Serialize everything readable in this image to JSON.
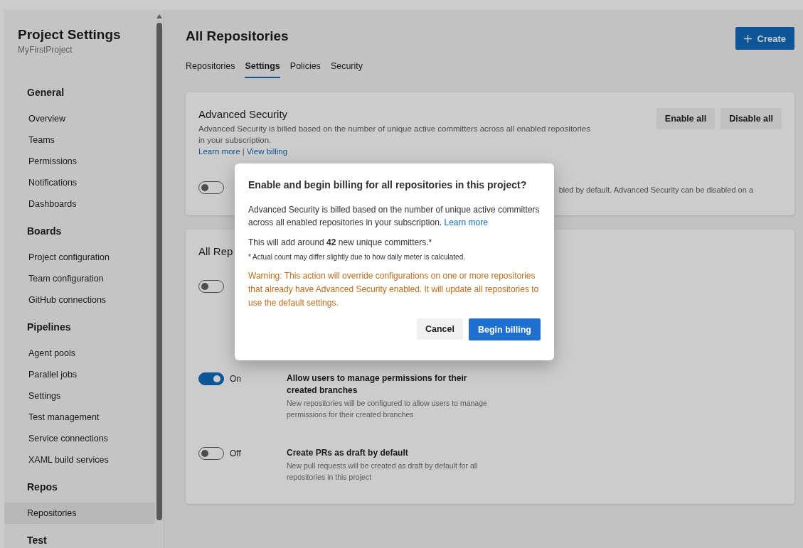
{
  "sidebar": {
    "title": "Project Settings",
    "subtitle": "MyFirstProject",
    "sections": [
      {
        "heading": "General",
        "items": [
          {
            "label": "Overview",
            "selected": false
          },
          {
            "label": "Teams",
            "selected": false
          },
          {
            "label": "Permissions",
            "selected": false
          },
          {
            "label": "Notifications",
            "selected": false
          },
          {
            "label": "Dashboards",
            "selected": false
          }
        ]
      },
      {
        "heading": "Boards",
        "items": [
          {
            "label": "Project configuration",
            "selected": false
          },
          {
            "label": "Team configuration",
            "selected": false
          },
          {
            "label": "GitHub connections",
            "selected": false
          }
        ]
      },
      {
        "heading": "Pipelines",
        "items": [
          {
            "label": "Agent pools",
            "selected": false
          },
          {
            "label": "Parallel jobs",
            "selected": false
          },
          {
            "label": "Settings",
            "selected": false
          },
          {
            "label": "Test management",
            "selected": false
          },
          {
            "label": "Service connections",
            "selected": false
          },
          {
            "label": "XAML build services",
            "selected": false
          }
        ]
      },
      {
        "heading": "Repos",
        "items": [
          {
            "label": "Repositories",
            "selected": true
          }
        ]
      },
      {
        "heading": "Test"
      }
    ]
  },
  "page": {
    "title": "All Repositories",
    "create_button": "Create",
    "tabs": [
      {
        "label": "Repositories",
        "selected": false
      },
      {
        "label": "Settings",
        "selected": true
      },
      {
        "label": "Policies",
        "selected": false
      },
      {
        "label": "Security",
        "selected": false
      }
    ]
  },
  "advanced_security": {
    "title": "Advanced Security",
    "description": "Advanced Security is billed based on the number of unique active committers across all enabled repositories in your subscription.",
    "links": [
      "Learn more",
      "View billing"
    ],
    "link_separator": "|",
    "buttons": [
      "Enable all",
      "Disable all"
    ],
    "toggle_on": false,
    "note": "bled by default. Advanced Security can be disabled on a"
  },
  "all_repositories": {
    "title": "All Rep",
    "settings": [
      {
        "on": false
      },
      {
        "on": true,
        "state_label": "On",
        "title": "Allow users to manage permissions for their created branches",
        "description": "New repositories will be configured to allow users to manage permissions for their created branches"
      },
      {
        "on": false,
        "state_label": "Off",
        "title": "Create PRs as draft by default",
        "description": "New pull requests will be created as draft by default for all repositories in this project"
      }
    ]
  },
  "dialog": {
    "title": "Enable and begin billing for all repositories in this project?",
    "body": "Advanced Security is billed based on the number of unique active committers across all enabled repositories in your subscription.",
    "body_link": "Learn more",
    "count": "This will add around **42** new unique committers.*",
    "footnote": "* Actual count may differ slightly due to how daily meter is calculated.",
    "warning": "Warning: This action will override configurations on one or more repositories that already have Advanced Security enabled. It will update all repositories to use the default settings.",
    "cancel": "Cancel",
    "confirm": "Begin billing"
  }
}
